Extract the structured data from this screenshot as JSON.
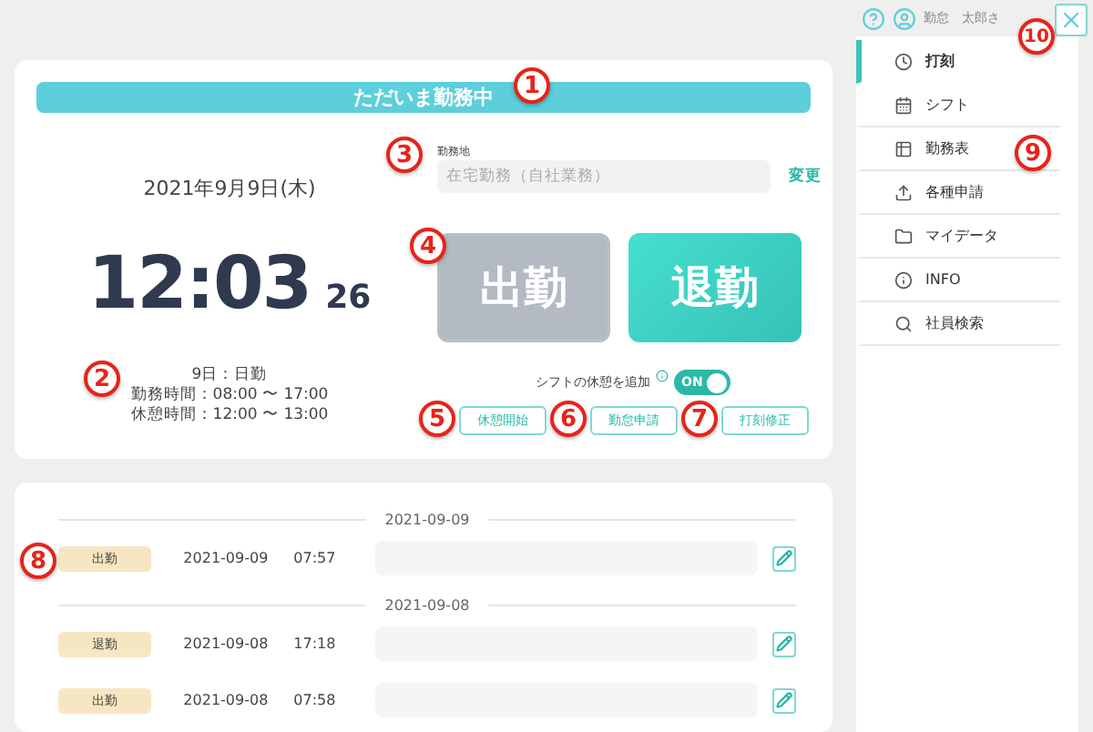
{
  "header": {
    "user_name": "勤怠　太郎さ"
  },
  "status_banner": {
    "text": "ただいま勤務中"
  },
  "clock": {
    "date": "2021年9月9日(木)",
    "time": "12:03",
    "seconds": "26"
  },
  "workplace": {
    "label": "勤務地",
    "value": "在宅勤務（自社業務）",
    "change_link": "変更"
  },
  "punch_buttons": [
    {
      "label": "出勤",
      "kind": "in",
      "disabled": true
    },
    {
      "label": "退勤",
      "kind": "out",
      "disabled": false
    }
  ],
  "shift_info": [
    "9日：日勤",
    "勤務時間：08:00 〜 17:00",
    "休憩時間：12:00 〜 13:00"
  ],
  "break_toggle": {
    "label": "シフトの休憩を追加",
    "on": true,
    "state_text": "ON"
  },
  "action_buttons": [
    "休憩開始",
    "勤怠申請",
    "打刻修正"
  ],
  "history": [
    {
      "date": "2021-09-09",
      "entries": [
        {
          "type": "出勤",
          "date": "2021-09-09",
          "time": "07:57"
        }
      ]
    },
    {
      "date": "2021-09-08",
      "entries": [
        {
          "type": "退勤",
          "date": "2021-09-08",
          "time": "17:18"
        },
        {
          "type": "出勤",
          "date": "2021-09-08",
          "time": "07:58"
        }
      ]
    }
  ],
  "sidebar": {
    "items": [
      {
        "label": "打刻",
        "kind": "clock",
        "selected": true
      },
      {
        "label": "シフト",
        "kind": "calendar",
        "selected": false
      },
      {
        "label": "勤務表",
        "kind": "table",
        "selected": false
      },
      {
        "label": "各種申請",
        "kind": "upload",
        "selected": false
      },
      {
        "label": "マイデータ",
        "kind": "folder",
        "selected": false
      },
      {
        "label": "INFO",
        "kind": "info",
        "selected": false
      },
      {
        "label": "社員検索",
        "kind": "search",
        "selected": false
      }
    ]
  },
  "callouts": [
    "1",
    "2",
    "3",
    "4",
    "5",
    "6",
    "7",
    "8",
    "9",
    "10"
  ]
}
